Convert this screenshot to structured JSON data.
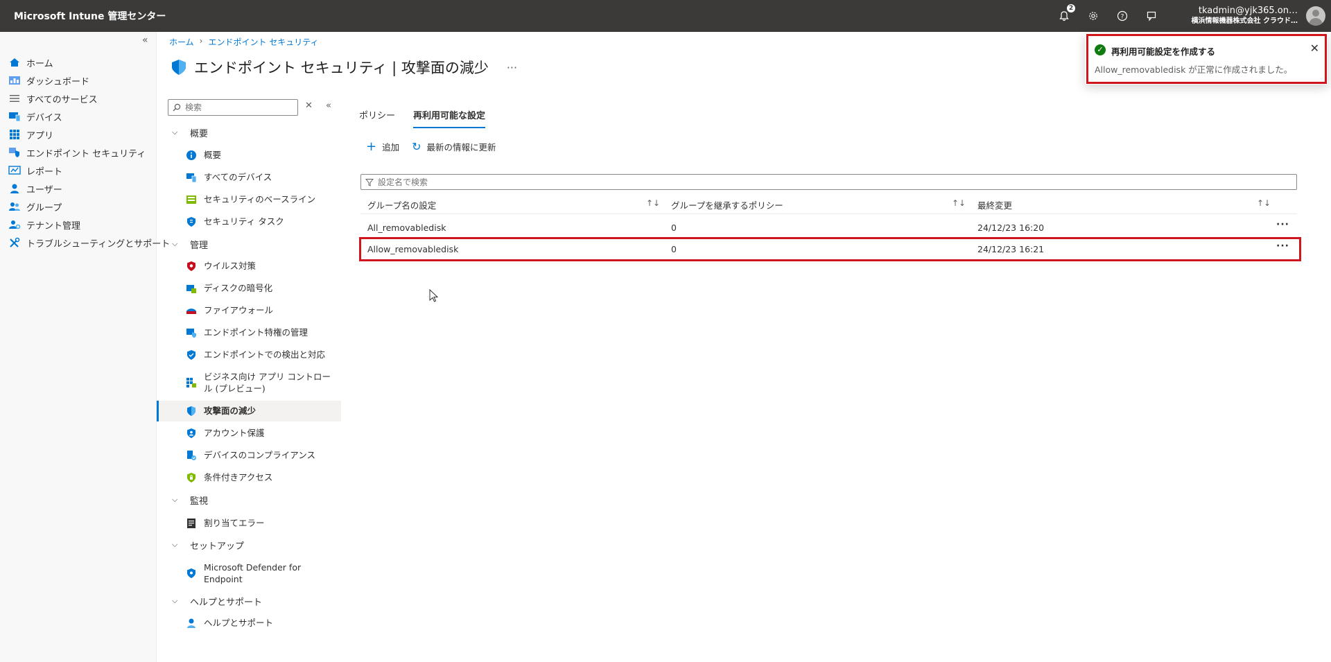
{
  "app": {
    "title": "Microsoft Intune 管理センター"
  },
  "topbar": {
    "notification_count": "2",
    "user_name": "tkadmin@yjk365.on…",
    "user_org": "横浜情報機器株式会社 クラウド…"
  },
  "leftnav": {
    "items": [
      {
        "label": "ホーム"
      },
      {
        "label": "ダッシュボード"
      },
      {
        "label": "すべてのサービス"
      },
      {
        "label": "デバイス"
      },
      {
        "label": "アプリ"
      },
      {
        "label": "エンドポイント セキュリティ"
      },
      {
        "label": "レポート"
      },
      {
        "label": "ユーザー"
      },
      {
        "label": "グループ"
      },
      {
        "label": "テナント管理"
      },
      {
        "label": "トラブルシューティングとサポート"
      }
    ]
  },
  "breadcrumb": {
    "home": "ホーム",
    "current": "エンドポイント セキュリティ"
  },
  "page": {
    "title": "エンドポイント セキュリティ | 攻撃面の減少",
    "more": "···"
  },
  "subnav": {
    "search_placeholder": "検索",
    "groups": {
      "overview": "概要",
      "manage": "管理",
      "monitor": "監視",
      "setup": "セットアップ",
      "help": "ヘルプとサポート"
    },
    "items": {
      "overview": "概要",
      "all_devices": "すべてのデバイス",
      "baselines": "セキュリティのベースライン",
      "tasks": "セキュリティ タスク",
      "antivirus": "ウイルス対策",
      "disk_encryption": "ディスクの暗号化",
      "firewall": "ファイアウォール",
      "privilege": "エンドポイント特権の管理",
      "edr": "エンドポイントでの検出と対応",
      "app_control_1": "ビジネス向け アプリ コントロー",
      "app_control_2": "ル (プレビュー)",
      "asr": "攻撃面の減少",
      "account": "アカウント保護",
      "compliance": "デバイスのコンプライアンス",
      "conditional": "条件付きアクセス",
      "assign_errors": "割り当てエラー",
      "defender_1": "Microsoft Defender for",
      "defender_2": "Endpoint",
      "help_support": "ヘルプとサポート"
    }
  },
  "tabs": [
    {
      "label": "ポリシー",
      "active": false
    },
    {
      "label": "再利用可能な設定",
      "active": true
    }
  ],
  "commands": {
    "add": "追加",
    "refresh": "最新の情報に更新"
  },
  "filter": {
    "placeholder": "設定名で検索"
  },
  "table": {
    "columns": [
      "グループ名の設定",
      "グループを継承するポリシー",
      "最終変更"
    ],
    "rows": [
      {
        "name": "All_removabledisk",
        "policies": "0",
        "modified": "24/12/23 16:20"
      },
      {
        "name": "Allow_removabledisk",
        "policies": "0",
        "modified": "24/12/23 16:21"
      }
    ]
  },
  "toast": {
    "title": "再利用可能設定を作成する",
    "message": "Allow_removabledisk が正常に作成されました。"
  },
  "colors": {
    "accent": "#0078d4",
    "highlight": "#d0151c",
    "success": "#107c10",
    "topbar": "#3b3a39"
  }
}
